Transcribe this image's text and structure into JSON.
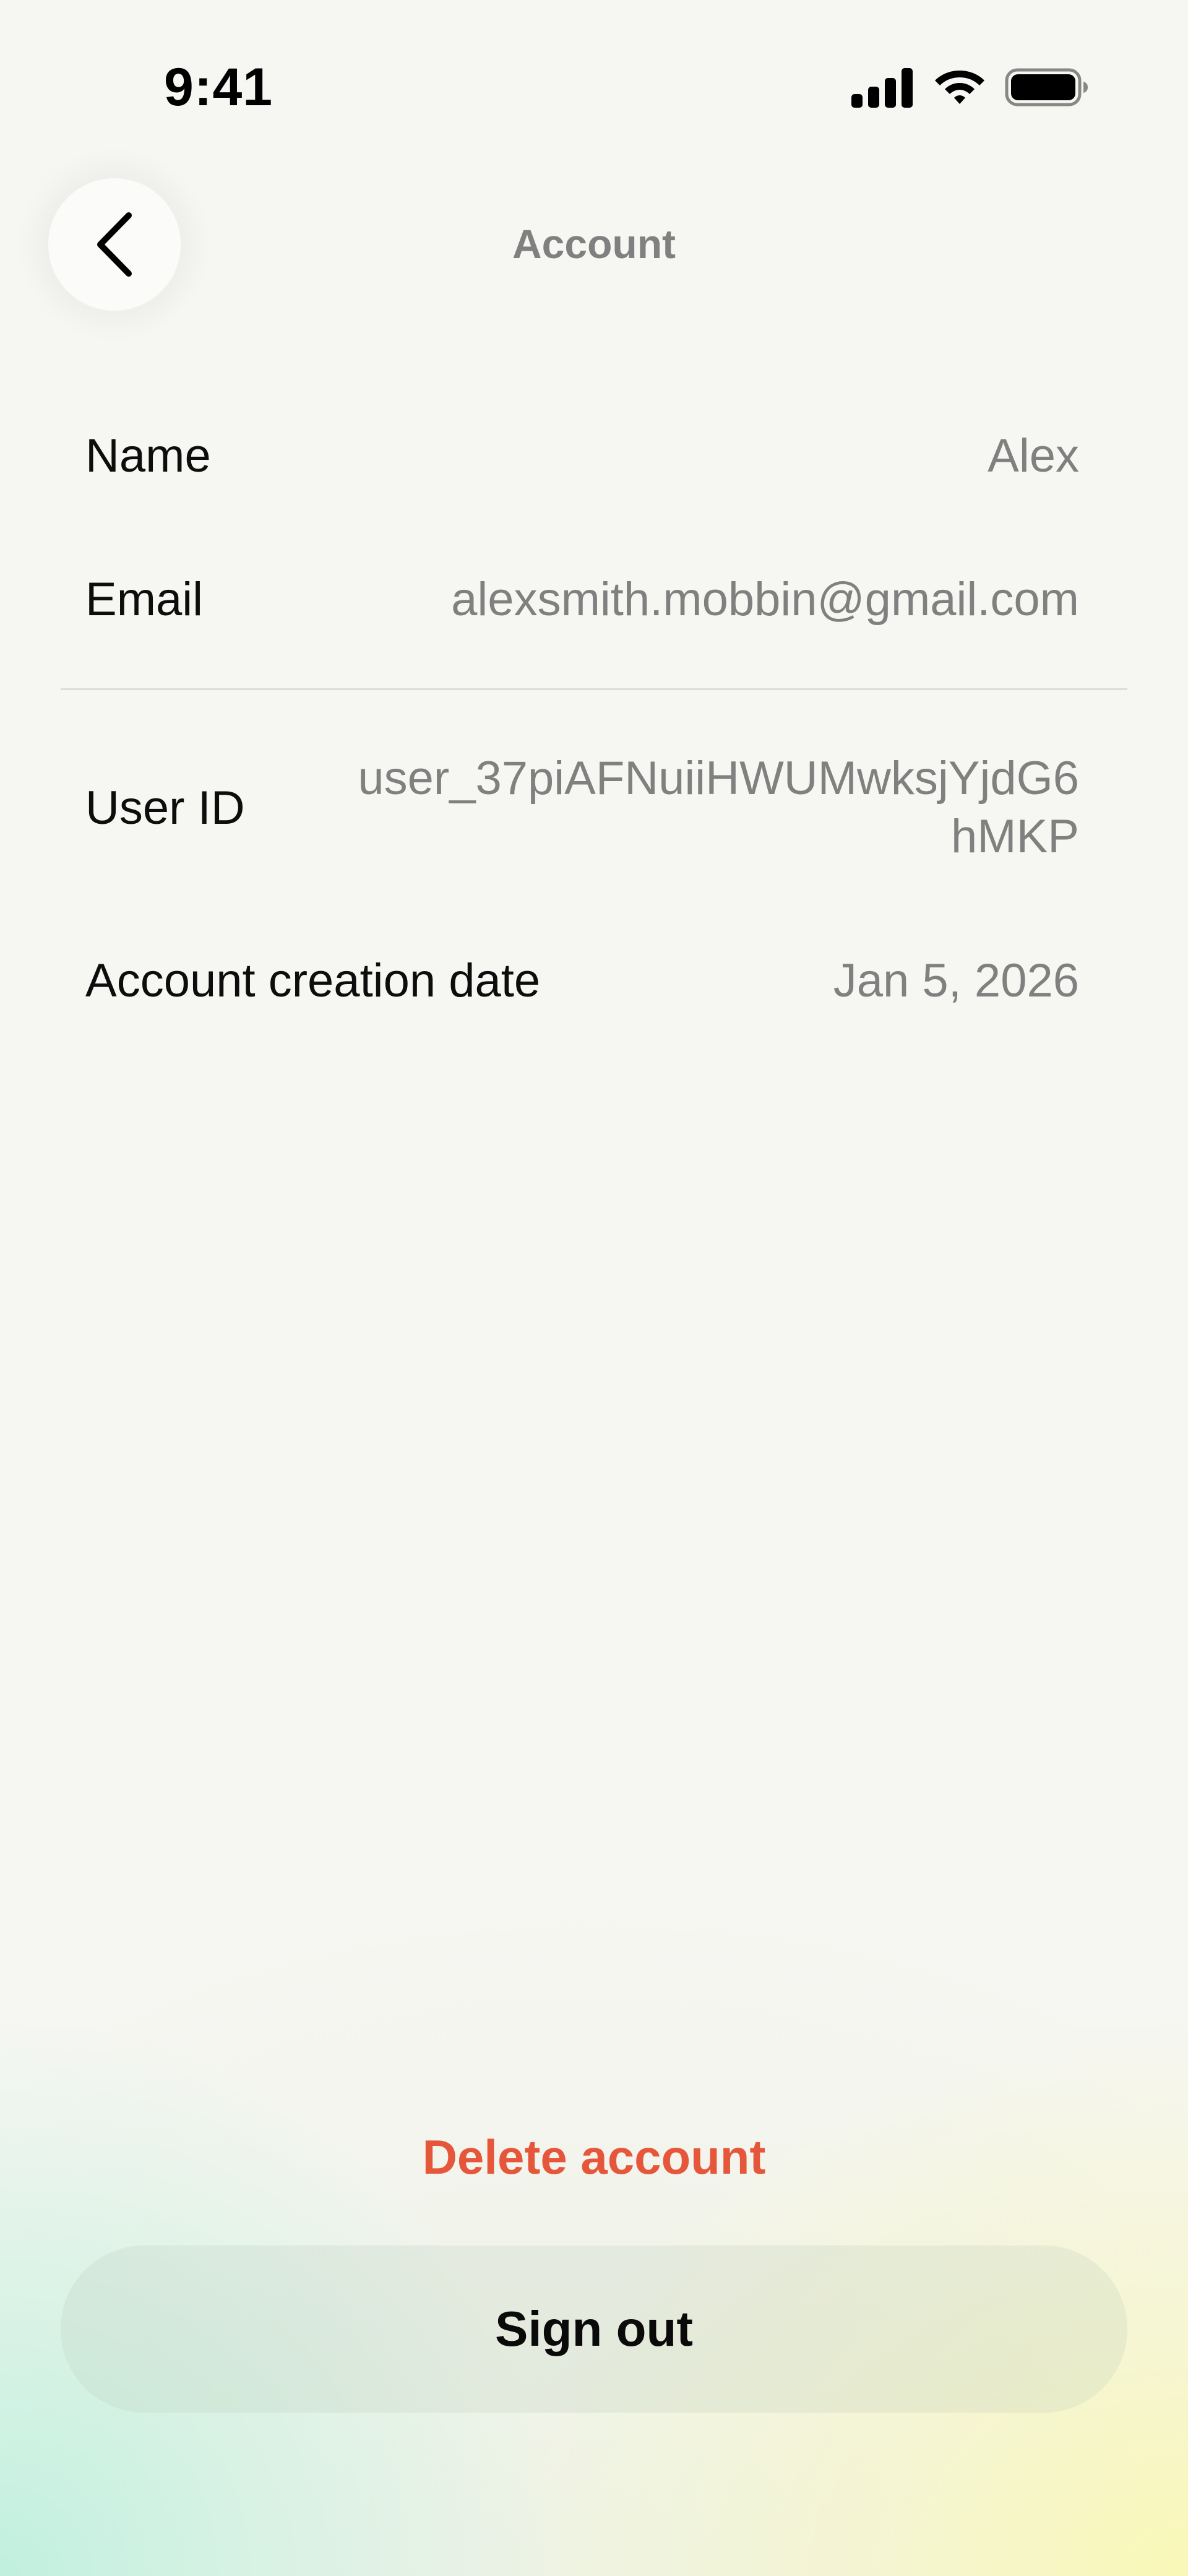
{
  "status_bar": {
    "time": "9:41",
    "icons": [
      "cellular-signal-icon",
      "wifi-icon",
      "battery-icon"
    ]
  },
  "header": {
    "back_icon": "chevron-left-icon",
    "title": "Account"
  },
  "account": {
    "name": {
      "label": "Name",
      "value": "Alex"
    },
    "email": {
      "label": "Email",
      "value": "alexsmith.mobbin@gmail.com"
    },
    "user_id": {
      "label": "User ID",
      "value": "user_37piAFNuiiHWUMwksjYjdG6hMKP"
    },
    "creation_date": {
      "label": "Account creation date",
      "value": "Jan 5, 2026"
    }
  },
  "actions": {
    "delete_label": "Delete account",
    "sign_out_label": "Sign out"
  },
  "colors": {
    "destructive": "#e5563a",
    "secondary_text": "#808080",
    "primary_text": "#0d0d0d"
  }
}
